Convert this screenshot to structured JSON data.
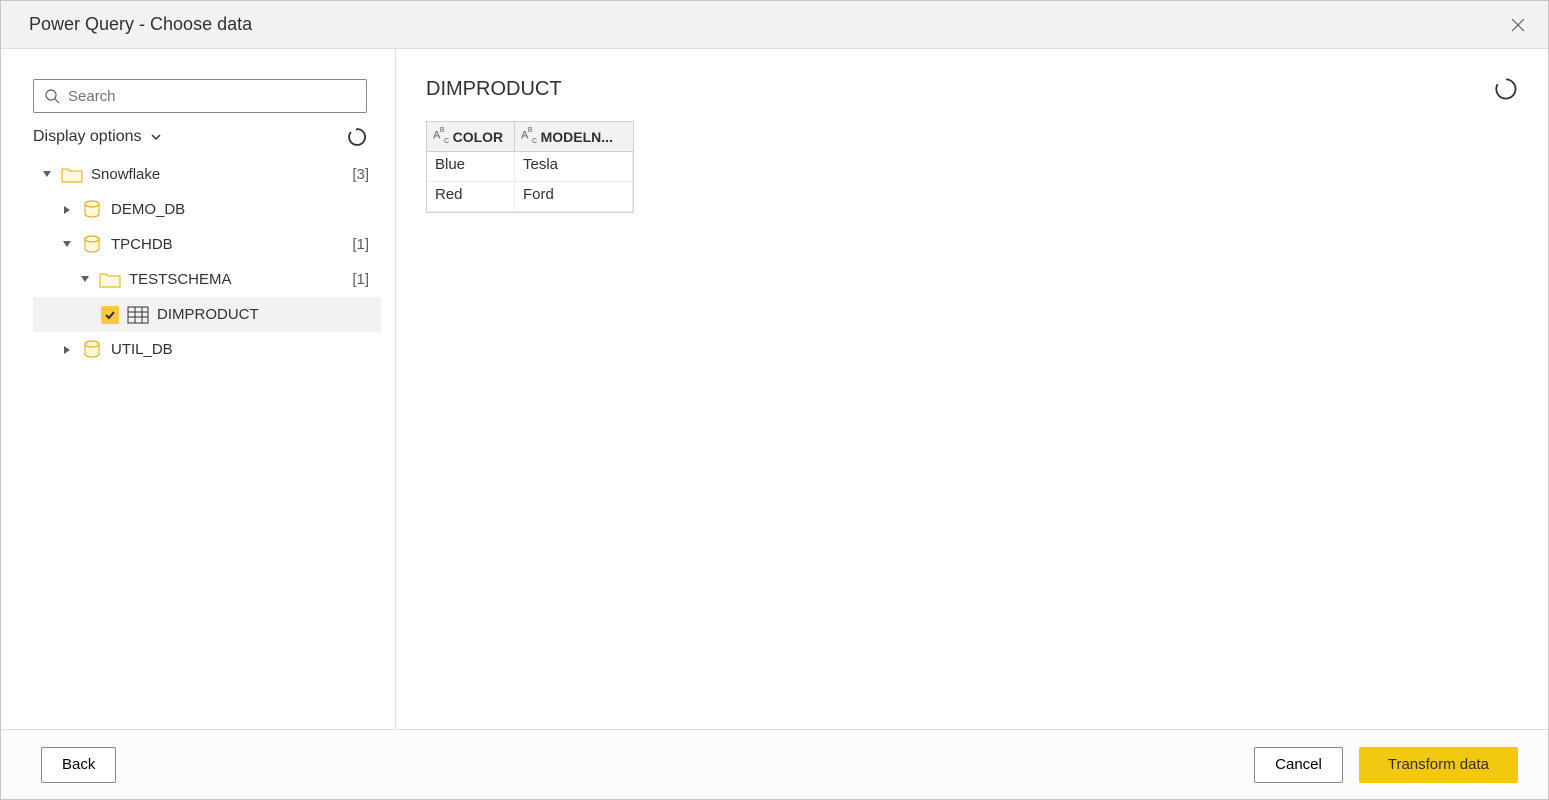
{
  "titlebar": {
    "title": "Power Query - Choose data"
  },
  "sidebar": {
    "search_placeholder": "Search",
    "display_options_label": "Display options",
    "tree": {
      "root": {
        "label": "Snowflake",
        "count": "[3]"
      },
      "demo_db": {
        "label": "DEMO_DB"
      },
      "tpchdb": {
        "label": "TPCHDB",
        "count": "[1]"
      },
      "testschema": {
        "label": "TESTSCHEMA",
        "count": "[1]"
      },
      "dimproduct": {
        "label": "DIMPRODUCT"
      },
      "util_db": {
        "label": "UTIL_DB"
      }
    }
  },
  "preview": {
    "title": "DIMPRODUCT",
    "columns": [
      "COLOR",
      "MODELN..."
    ],
    "rows": [
      {
        "color": "Blue",
        "model": "Tesla"
      },
      {
        "color": "Red",
        "model": "Ford"
      }
    ]
  },
  "footer": {
    "back_label": "Back",
    "cancel_label": "Cancel",
    "transform_label": "Transform data"
  }
}
